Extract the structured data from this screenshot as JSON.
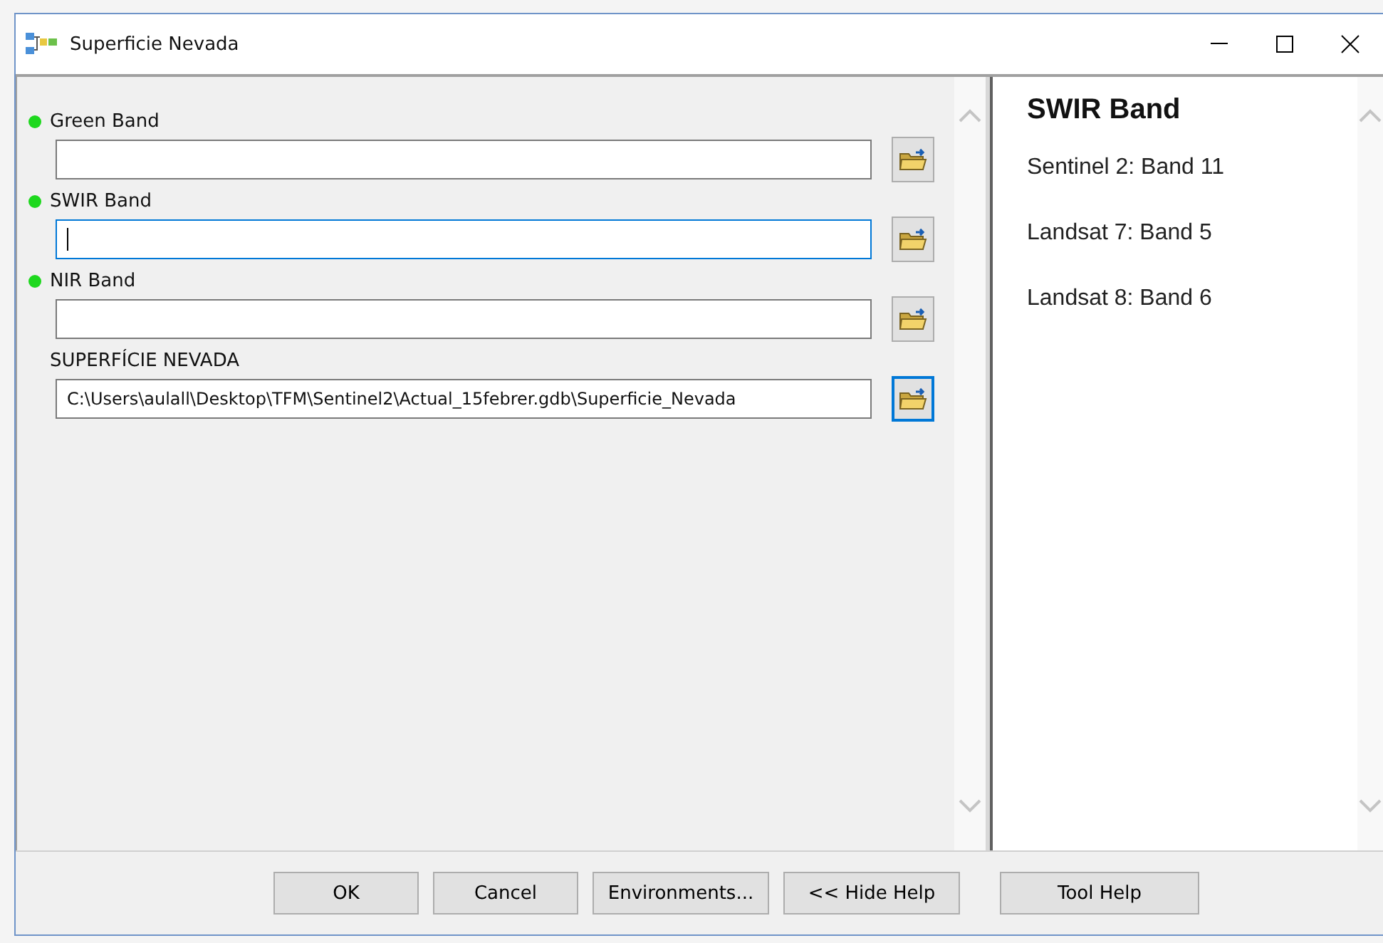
{
  "window": {
    "title": "Superficie Nevada"
  },
  "parameters": [
    {
      "label": "Green Band",
      "required": true,
      "focused": false,
      "browse_focused": false
    },
    {
      "label": "SWIR Band",
      "required": true,
      "focused": true,
      "browse_focused": false
    },
    {
      "label": "NIR Band",
      "required": true,
      "focused": false,
      "browse_focused": false
    },
    {
      "label": "SUPERFÍCIE NEVADA",
      "required": false,
      "value": "C:\\Users\\aulall\\Desktop\\TFM\\Sentinel2\\Actual_15febrer.gdb\\Superficie_Nevada",
      "focused": false,
      "browse_focused": true
    }
  ],
  "help": {
    "title": "SWIR Band",
    "lines": [
      "Sentinel 2: Band 11",
      "Landsat 7: Band 5",
      "Landsat 8: Band 6"
    ]
  },
  "buttons": [
    "OK",
    "Cancel",
    "Environments...",
    "<< Hide Help"
  ],
  "tool_help_button": "Tool Help"
}
